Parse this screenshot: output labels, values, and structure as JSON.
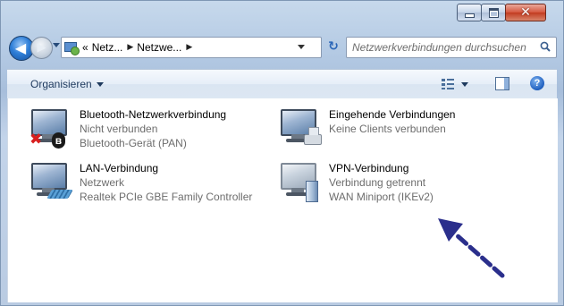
{
  "window": {
    "caption_buttons": {
      "minimize_icon": "minimize-icon",
      "maximize_icon": "maximize-icon",
      "close_icon": "close-icon",
      "close_glyph": "✕"
    }
  },
  "nav": {
    "back_glyph": "◀",
    "forward_glyph": "▶",
    "breadcrumb": {
      "overflow": "«",
      "items": [
        "Netz...",
        "Netzwe..."
      ],
      "separator": "▶"
    },
    "refresh_glyph": "↻",
    "search_placeholder": "Netzwerkverbindungen durchsuchen"
  },
  "commandbar": {
    "organize_label": "Organisieren",
    "help_glyph": "?"
  },
  "connections": [
    {
      "name": "Bluetooth-Netzwerkverbindung",
      "status": "Nicht verbunden",
      "device": "Bluetooth-Gerät (PAN)",
      "icon": "bluetooth-network-icon",
      "error_glyph": "✖",
      "badge_glyph": "ʙ"
    },
    {
      "name": "Eingehende Verbindungen",
      "status": "Keine Clients verbunden",
      "device": "",
      "icon": "incoming-connections-icon"
    },
    {
      "name": "LAN-Verbindung",
      "status": "Netzwerk",
      "device": "Realtek PCIe GBE Family Controller",
      "icon": "lan-connection-icon"
    },
    {
      "name": "VPN-Verbindung",
      "status": "Verbindung getrennt",
      "device": "WAN Miniport (IKEv2)",
      "icon": "vpn-connection-icon"
    }
  ],
  "colors": {
    "arrow": "#2b2f8c",
    "error": "#d81f1f",
    "secondary_text": "#6d6d6d"
  }
}
